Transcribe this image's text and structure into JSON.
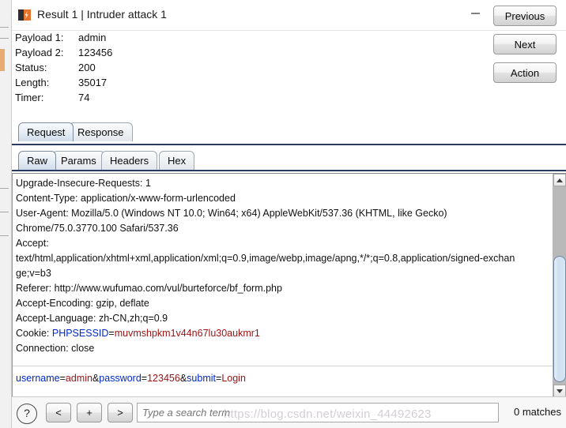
{
  "window": {
    "title": "Result 1 | Intruder attack 1",
    "icon": "burp-logo-icon",
    "controls": {
      "minimize": "minimize-icon",
      "maximize": "maximize-icon",
      "close": "close-icon"
    }
  },
  "summary": {
    "rows": [
      {
        "label": "Payload 1:",
        "value": "admin"
      },
      {
        "label": "Payload 2:",
        "value": "123456"
      },
      {
        "label": "Status:",
        "value": "200"
      },
      {
        "label": "Length:",
        "value": "35017"
      },
      {
        "label": "Timer:",
        "value": "74"
      }
    ]
  },
  "actions": {
    "previous": "Previous",
    "next": "Next",
    "action": "Action"
  },
  "outer_tabs": [
    {
      "label": "Request",
      "selected": true
    },
    {
      "label": "Response",
      "selected": false
    }
  ],
  "inner_tabs": [
    {
      "label": "Raw",
      "selected": true
    },
    {
      "label": "Params",
      "selected": false
    },
    {
      "label": "Headers",
      "selected": false
    },
    {
      "label": "Hex",
      "selected": false
    }
  ],
  "editor": {
    "headers": [
      "Upgrade-Insecure-Requests: 1",
      "Content-Type: application/x-www-form-urlencoded",
      "User-Agent: Mozilla/5.0 (Windows NT 10.0; Win64; x64) AppleWebKit/537.36 (KHTML, like Gecko)",
      "Chrome/75.0.3770.100 Safari/537.36",
      "Accept:",
      "text/html,application/xhtml+xml,application/xml;q=0.9,image/webp,image/apng,*/*;q=0.8,application/signed-exchan",
      "ge;v=b3",
      "Referer: http://www.wufumao.com/vul/burteforce/bf_form.php",
      "Accept-Encoding: gzip, deflate",
      "Accept-Language: zh-CN,zh;q=0.9"
    ],
    "cookie_line": {
      "prefix": "Cookie: ",
      "name": "PHPSESSID",
      "equals": "=",
      "value": "muvmshpkm1v44n67lu30aukmr1"
    },
    "connection_line": "Connection: close",
    "body": [
      {
        "name": "username",
        "eq": "=",
        "value": "admin",
        "sep": "&"
      },
      {
        "name": "password",
        "eq": "=",
        "value": "123456",
        "sep": "&"
      },
      {
        "name": "submit",
        "eq": "=",
        "value": "Login",
        "sep": ""
      }
    ]
  },
  "bottom_bar": {
    "help": "?",
    "prev_match": "<",
    "add_match": "+",
    "next_match": ">",
    "search_value": "",
    "search_placeholder": "Type a search term",
    "match_count": "0 matches"
  },
  "watermark": "https://blog.csdn.net/weixin_44492623",
  "colors": {
    "accent_rule": "#2b3a63",
    "token_name": "#0028c8",
    "token_value": "#9b1313",
    "brand_orange": "#e8732a",
    "brand_dark": "#2f2f33"
  }
}
